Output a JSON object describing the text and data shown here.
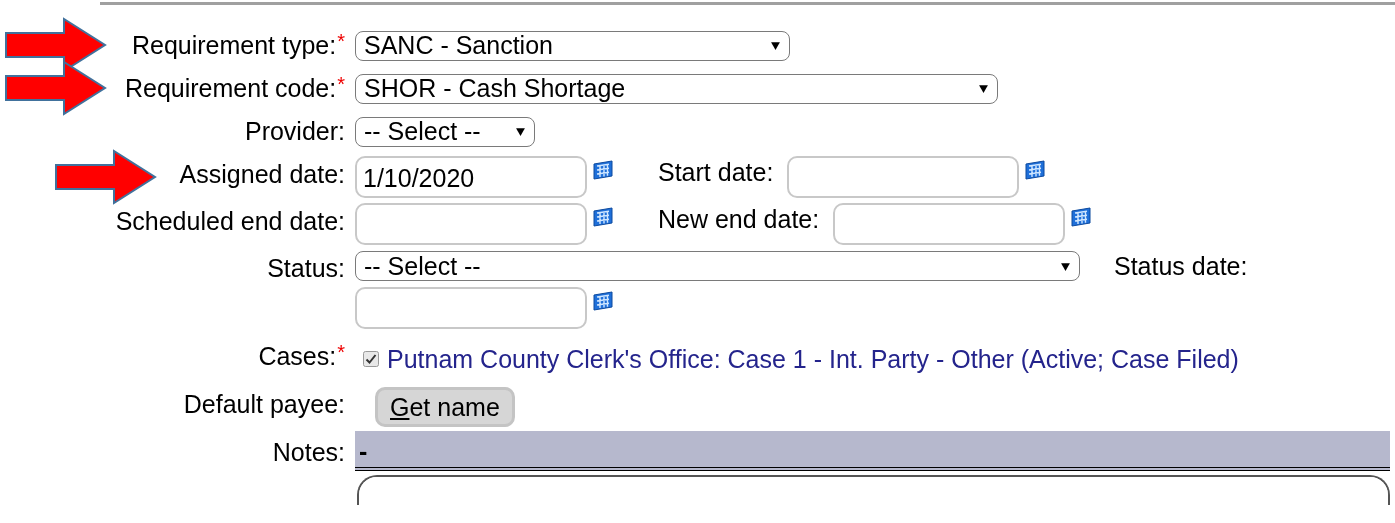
{
  "rows": [
    {
      "kind": "single",
      "label": "Requirement type:",
      "required_mark": "*",
      "arrow": true,
      "controls": [
        {
          "kind": "select",
          "value": "SANC - Sanction"
        }
      ]
    },
    {
      "kind": "single",
      "label": "Requirement code:",
      "required_mark": "*",
      "arrow": true,
      "controls": [
        {
          "kind": "select",
          "value": "SHOR - Cash Shortage"
        }
      ]
    },
    {
      "kind": "single",
      "label": "Provider:",
      "controls": [
        {
          "kind": "select",
          "value": "-- Select --"
        }
      ]
    },
    {
      "kind": "single",
      "label": "Assigned date:",
      "arrow": true,
      "controls": [
        {
          "kind": "date",
          "value": "1/10/2020"
        },
        {
          "kind": "label",
          "text": "Start date:"
        },
        {
          "kind": "date"
        }
      ]
    },
    {
      "kind": "single",
      "label": "Scheduled end date:",
      "controls": [
        {
          "kind": "date"
        },
        {
          "kind": "label",
          "text": "New end date:"
        },
        {
          "kind": "date"
        }
      ]
    },
    {
      "kind": "status",
      "label": "Status:",
      "controls": [
        {
          "kind": "select",
          "value": "-- Select --"
        },
        {
          "kind": "label",
          "text": "Status date:"
        },
        {
          "kind": "date"
        }
      ]
    },
    {
      "kind": "single",
      "label": "Cases:",
      "required_mark": "*",
      "controls": [
        {
          "kind": "checkbox",
          "checked": true,
          "text": "Putnam County Clerk's Office: Case 1 - Int. Party - Other (Active; Case Filed)"
        }
      ]
    },
    {
      "kind": "single",
      "label": "Default payee:",
      "controls": [
        {
          "kind": "button",
          "text": "Get name"
        }
      ]
    },
    {
      "kind": "notes",
      "label": "Notes:",
      "controls": [
        {
          "kind": "toolbar",
          "text": "-"
        },
        {
          "kind": "textarea"
        }
      ]
    }
  ]
}
